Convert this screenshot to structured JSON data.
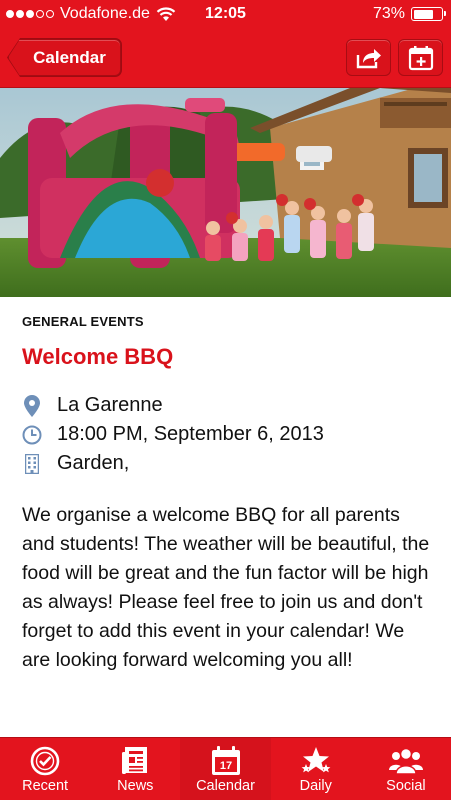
{
  "status_bar": {
    "carrier": "Vodafone.de",
    "time": "12:05",
    "battery_percent": "73%",
    "battery_level": 0.73,
    "signal_bars_full": 3,
    "signal_bars_total": 5
  },
  "nav": {
    "back_label": "Calendar",
    "share_icon": "share-icon",
    "add_calendar_icon": "add-to-calendar-icon"
  },
  "event": {
    "category": "GENERAL EVENTS",
    "title": "Welcome BBQ",
    "location": "La Garenne",
    "datetime": "18:00 PM, September 6, 2013",
    "venue": "Garden,",
    "description": "We organise a welcome BBQ for all parents and students! The weather will be beautiful, the food will be great and the fun factor will be high as always! Please feel free to join us and don't forget to add this event in your calendar! We are looking forward welcoming you all!"
  },
  "tabs": [
    {
      "label": "Recent",
      "icon": "clock-icon"
    },
    {
      "label": "News",
      "icon": "newspaper-icon"
    },
    {
      "label": "Calendar",
      "icon": "calendar-icon",
      "badge": "17"
    },
    {
      "label": "Daily",
      "icon": "stars-icon"
    },
    {
      "label": "Social",
      "icon": "people-icon"
    }
  ],
  "colors": {
    "brand_red": "#e3141e",
    "title_red": "#d9121b",
    "icon_blue": "#6e8fb8"
  }
}
